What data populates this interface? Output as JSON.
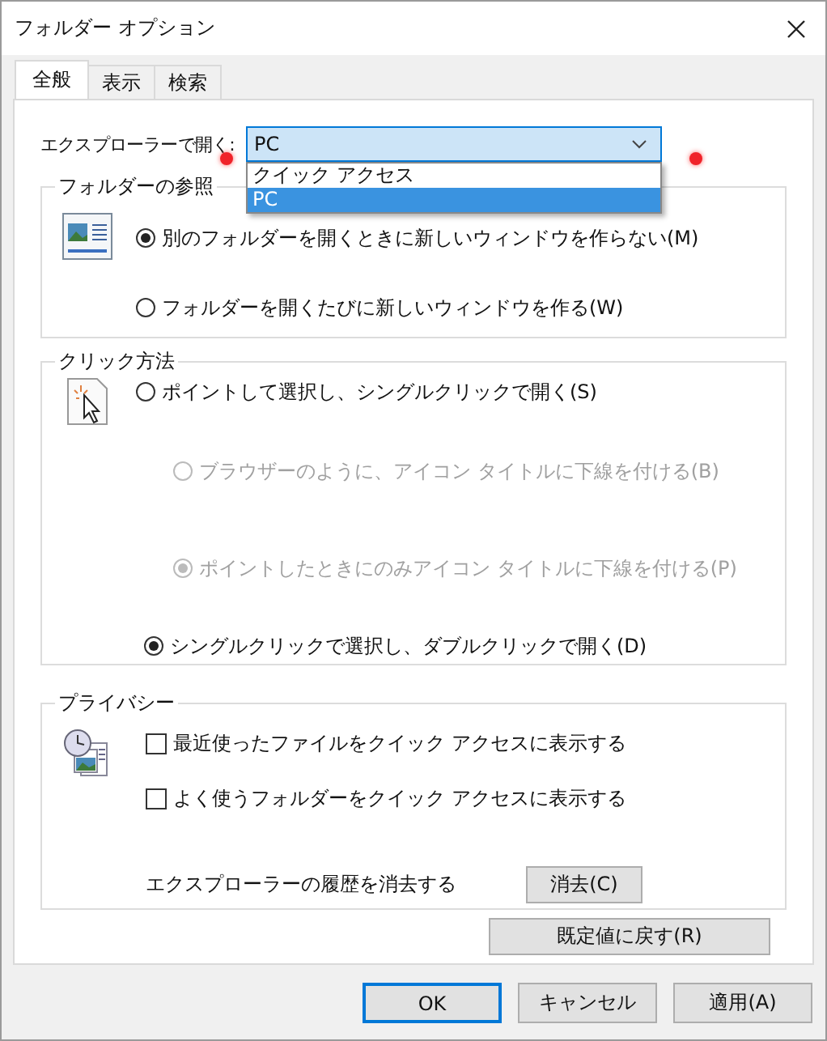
{
  "window": {
    "title": "フォルダー オプション"
  },
  "tabs": [
    {
      "label": "全般",
      "selected": true
    },
    {
      "label": "表示",
      "selected": false
    },
    {
      "label": "検索",
      "selected": false
    }
  ],
  "open_in": {
    "label": "エクスプローラーで開く:",
    "value": "PC",
    "expanded": true,
    "options": [
      {
        "label": "クイック アクセス",
        "selected": false
      },
      {
        "label": "PC",
        "selected": true
      }
    ]
  },
  "browse_folders": {
    "title": "フォルダーの参照",
    "options": [
      {
        "label": "別のフォルダーを開くときに新しいウィンドウを作らない(M)",
        "selected": true,
        "disabled": false
      },
      {
        "label": "フォルダーを開くたびに新しいウィンドウを作る(W)",
        "selected": false,
        "disabled": false
      }
    ]
  },
  "click_items": {
    "title": "クリック方法",
    "options": [
      {
        "kind": "main",
        "label": "ポイントして選択し、シングルクリックで開く(S)",
        "selected": false,
        "disabled": false
      },
      {
        "kind": "sub",
        "label": "ブラウザーのように、アイコン タイトルに下線を付ける(B)",
        "selected": false,
        "disabled": true
      },
      {
        "kind": "sub",
        "label": "ポイントしたときにのみアイコン タイトルに下線を付ける(P)",
        "selected": true,
        "disabled": true
      },
      {
        "kind": "main",
        "label": "シングルクリックで選択し、ダブルクリックで開く(D)",
        "selected": true,
        "disabled": false
      }
    ]
  },
  "privacy": {
    "title": "プライバシー",
    "checkboxes": [
      {
        "label": "最近使ったファイルをクイック アクセスに表示する",
        "checked": false
      },
      {
        "label": "よく使うフォルダーをクイック アクセスに表示する",
        "checked": false
      }
    ],
    "clear_label": "エクスプローラーの履歴を消去する",
    "clear_button": "消去(C)"
  },
  "restore_button": "既定値に戻す(R)",
  "buttons": [
    {
      "label": "OK",
      "default": true
    },
    {
      "label": "キャンセル",
      "default": false
    },
    {
      "label": "適用(A)",
      "default": false
    }
  ]
}
